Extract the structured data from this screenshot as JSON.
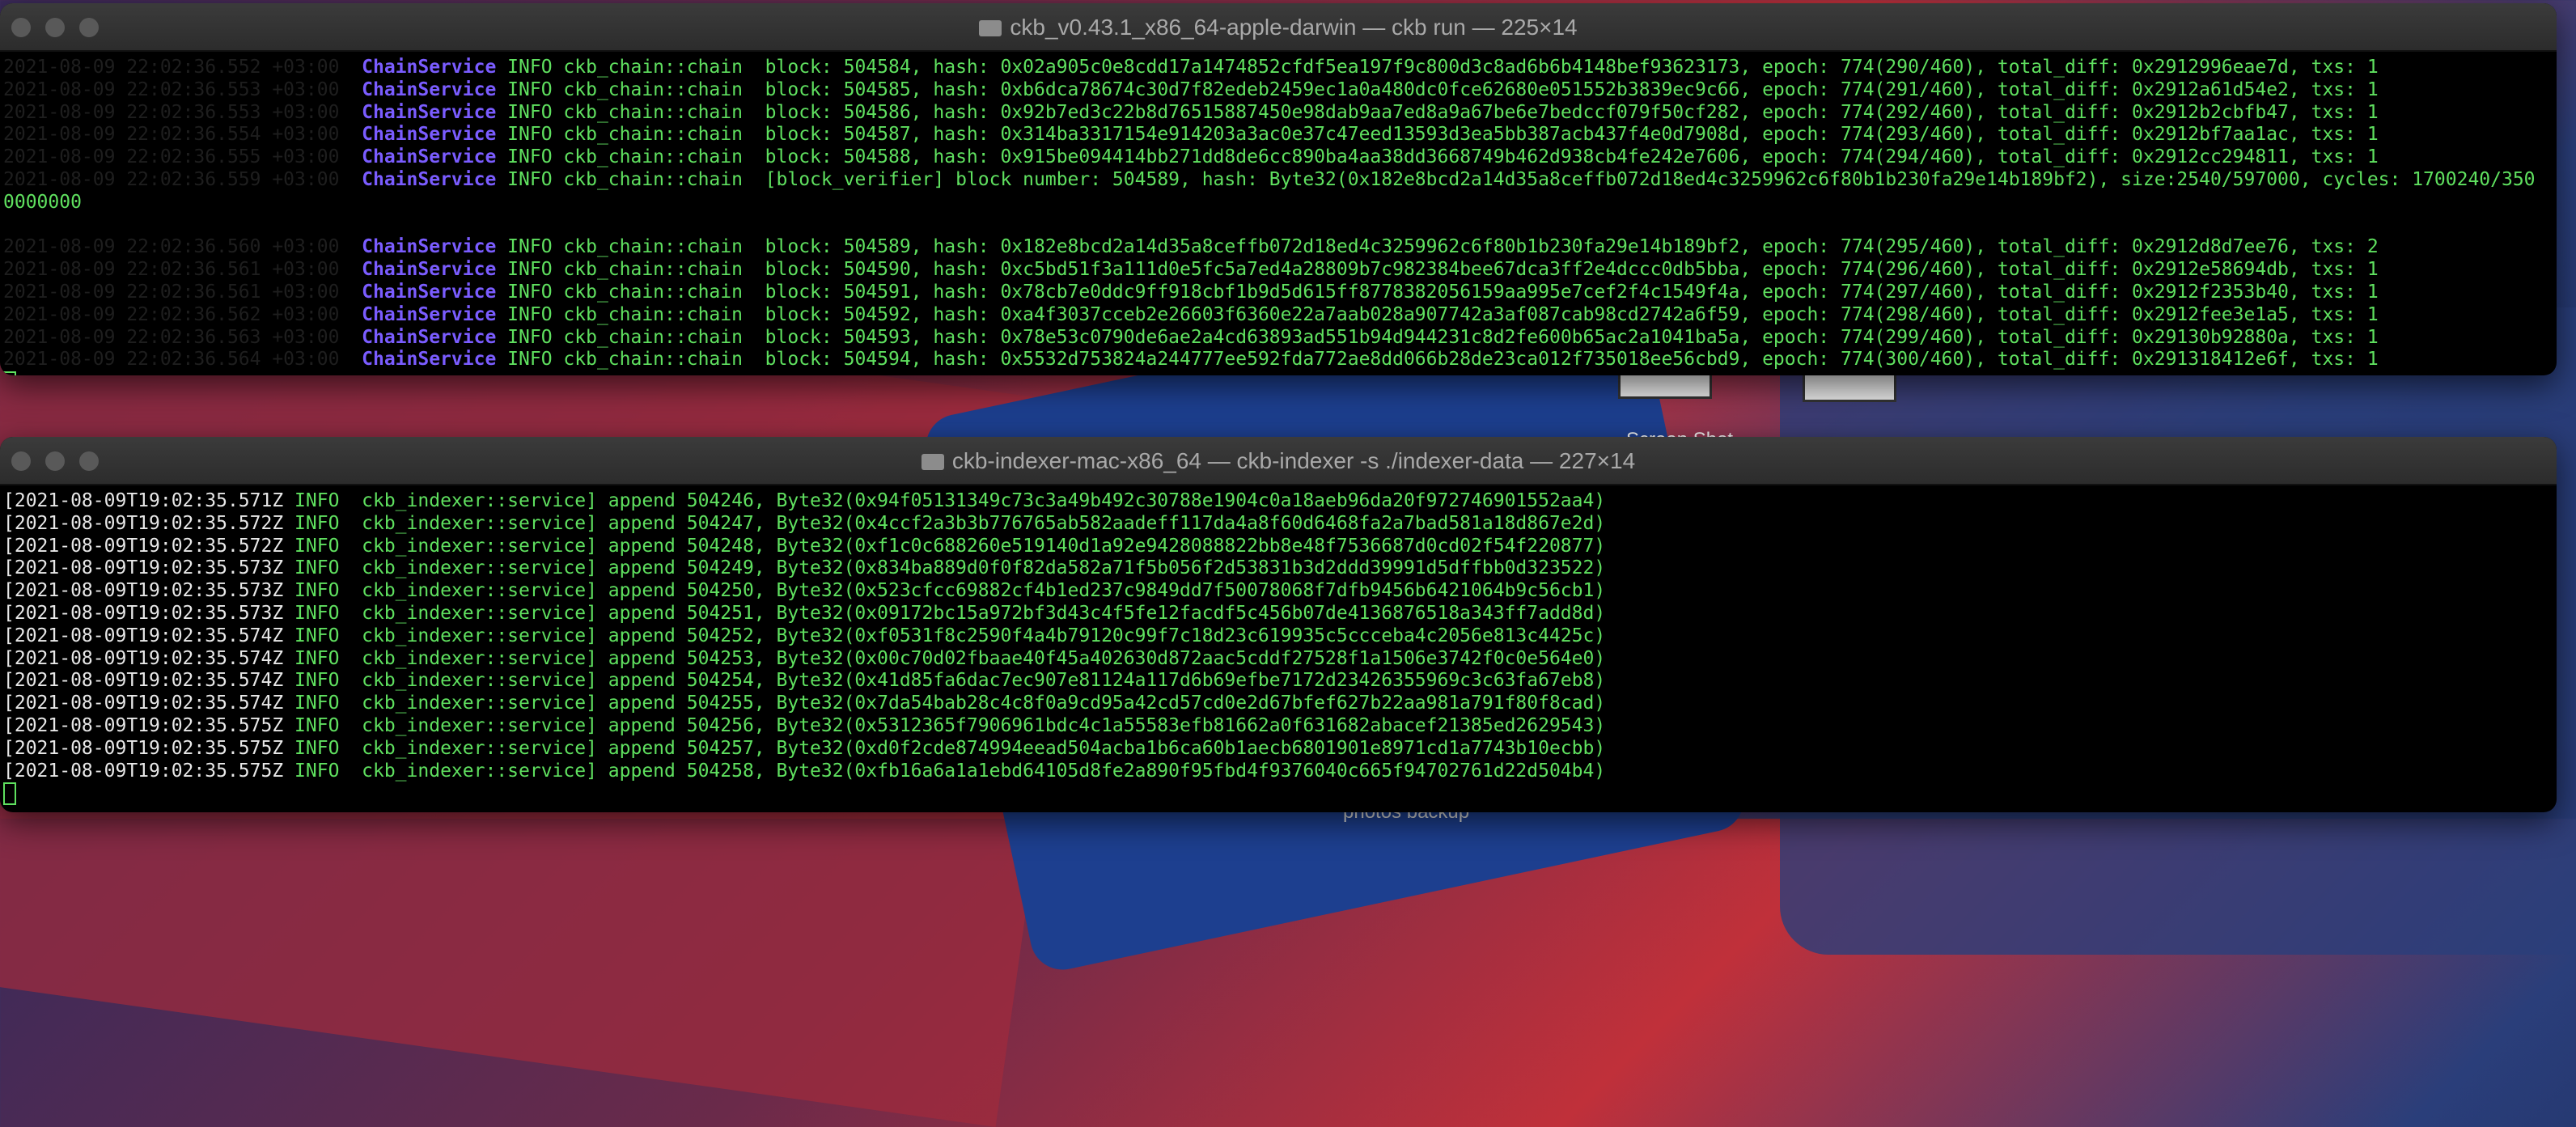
{
  "desktop": {
    "label1": "Screen Shot...",
    "label2": "photos backup"
  },
  "window1": {
    "title": "ckb_v0.43.1_x86_64-apple-darwin — ckb run — 225×14",
    "lines": [
      {
        "ts": "2021-08-09 22:02:36.552 +03:00",
        "svc": "ChainService",
        "lvl": "INFO",
        "mod": "ckb_chain::chain",
        "msg": "block: 504584, hash: 0x02a905c0e8cdd17a1474852cfdf5ea197f9c800d3c8ad6b6b4148bef93623173, epoch: 774(290/460), total_diff: 0x2912996eae7d, txs: 1"
      },
      {
        "ts": "2021-08-09 22:02:36.553 +03:00",
        "svc": "ChainService",
        "lvl": "INFO",
        "mod": "ckb_chain::chain",
        "msg": "block: 504585, hash: 0xb6dca78674c30d7f82edeb2459ec1a0a480dc0fce62680e051552b3839ec9c66, epoch: 774(291/460), total_diff: 0x2912a61d54e2, txs: 1"
      },
      {
        "ts": "2021-08-09 22:02:36.553 +03:00",
        "svc": "ChainService",
        "lvl": "INFO",
        "mod": "ckb_chain::chain",
        "msg": "block: 504586, hash: 0x92b7ed3c22b8d76515887450e98dab9aa7ed8a9a67be6e7bedccf079f50cf282, epoch: 774(292/460), total_diff: 0x2912b2cbfb47, txs: 1"
      },
      {
        "ts": "2021-08-09 22:02:36.554 +03:00",
        "svc": "ChainService",
        "lvl": "INFO",
        "mod": "ckb_chain::chain",
        "msg": "block: 504587, hash: 0x314ba3317154e914203a3ac0e37c47eed13593d3ea5bb387acb437f4e0d7908d, epoch: 774(293/460), total_diff: 0x2912bf7aa1ac, txs: 1"
      },
      {
        "ts": "2021-08-09 22:02:36.555 +03:00",
        "svc": "ChainService",
        "lvl": "INFO",
        "mod": "ckb_chain::chain",
        "msg": "block: 504588, hash: 0x915be094414bb271dd8de6cc890ba4aa38dd3668749b462d938cb4fe242e7606, epoch: 774(294/460), total_diff: 0x2912cc294811, txs: 1"
      },
      {
        "ts": "2021-08-09 22:02:36.559 +03:00",
        "svc": "ChainService",
        "lvl": "INFO",
        "mod": "ckb_chain::chain",
        "msg": "[block_verifier] block number: 504589, hash: Byte32(0x182e8bcd2a14d35a8ceffb072d18ed4c3259962c6f80b1b230fa29e14b189bf2), size:2540/597000, cycles: 1700240/350"
      },
      {
        "ts": "",
        "svc": "",
        "lvl": "",
        "mod": "",
        "msg": "",
        "cont": "0000000"
      },
      {
        "ts": "2021-08-09 22:02:36.560 +03:00",
        "svc": "ChainService",
        "lvl": "INFO",
        "mod": "ckb_chain::chain",
        "msg": "block: 504589, hash: 0x182e8bcd2a14d35a8ceffb072d18ed4c3259962c6f80b1b230fa29e14b189bf2, epoch: 774(295/460), total_diff: 0x2912d8d7ee76, txs: 2"
      },
      {
        "ts": "2021-08-09 22:02:36.561 +03:00",
        "svc": "ChainService",
        "lvl": "INFO",
        "mod": "ckb_chain::chain",
        "msg": "block: 504590, hash: 0xc5bd51f3a111d0e5fc5a7ed4a28809b7c982384bee67dca3ff2e4dccc0db5bba, epoch: 774(296/460), total_diff: 0x2912e58694db, txs: 1"
      },
      {
        "ts": "2021-08-09 22:02:36.561 +03:00",
        "svc": "ChainService",
        "lvl": "INFO",
        "mod": "ckb_chain::chain",
        "msg": "block: 504591, hash: 0x78cb7e0ddc9ff918cbf1b9d5d615ff8778382056159aa995e7cef2f4c1549f4a, epoch: 774(297/460), total_diff: 0x2912f2353b40, txs: 1"
      },
      {
        "ts": "2021-08-09 22:02:36.562 +03:00",
        "svc": "ChainService",
        "lvl": "INFO",
        "mod": "ckb_chain::chain",
        "msg": "block: 504592, hash: 0xa4f3037cceb2e26603f6360e22a7aab028a907742a3af087cab98cd2742a6f59, epoch: 774(298/460), total_diff: 0x2912fee3e1a5, txs: 1"
      },
      {
        "ts": "2021-08-09 22:02:36.563 +03:00",
        "svc": "ChainService",
        "lvl": "INFO",
        "mod": "ckb_chain::chain",
        "msg": "block: 504593, hash: 0x78e53c0790de6ae2a4cd63893ad551b94d944231c8d2fe600b65ac2a1041ba5a, epoch: 774(299/460), total_diff: 0x29130b92880a, txs: 1"
      },
      {
        "ts": "2021-08-09 22:02:36.564 +03:00",
        "svc": "ChainService",
        "lvl": "INFO",
        "mod": "ckb_chain::chain",
        "msg": "block: 504594, hash: 0x5532d753824a244777ee592fda772ae8dd066b28de23ca012f735018ee56cbd9, epoch: 774(300/460), total_diff: 0x291318412e6f, txs: 1"
      }
    ]
  },
  "window2": {
    "title": "ckb-indexer-mac-x86_64 — ckb-indexer -s ./indexer-data — 227×14",
    "lines": [
      {
        "ts": "[2021-08-09T19:02:35.571Z",
        "lvl": "INFO",
        "mod": "ckb_indexer::service]",
        "msg": "append 504246, Byte32(0x94f05131349c73c3a49b492c30788e1904c0a18aeb96da20f972746901552aa4)"
      },
      {
        "ts": "[2021-08-09T19:02:35.572Z",
        "lvl": "INFO",
        "mod": "ckb_indexer::service]",
        "msg": "append 504247, Byte32(0x4ccf2a3b3b776765ab582aadeff117da4a8f60d6468fa2a7bad581a18d867e2d)"
      },
      {
        "ts": "[2021-08-09T19:02:35.572Z",
        "lvl": "INFO",
        "mod": "ckb_indexer::service]",
        "msg": "append 504248, Byte32(0xf1c0c688260e519140d1a92e9428088822bb8e48f7536687d0cd02f54f220877)"
      },
      {
        "ts": "[2021-08-09T19:02:35.573Z",
        "lvl": "INFO",
        "mod": "ckb_indexer::service]",
        "msg": "append 504249, Byte32(0x834ba889d0f0f82da582a71f5b056f2d53831b3d2ddd39991d5dffbb0d323522)"
      },
      {
        "ts": "[2021-08-09T19:02:35.573Z",
        "lvl": "INFO",
        "mod": "ckb_indexer::service]",
        "msg": "append 504250, Byte32(0x523cfcc69882cf4b1ed237c9849dd7f50078068f7dfb9456b6421064b9c56cb1)"
      },
      {
        "ts": "[2021-08-09T19:02:35.573Z",
        "lvl": "INFO",
        "mod": "ckb_indexer::service]",
        "msg": "append 504251, Byte32(0x09172bc15a972bf3d43c4f5fe12facdf5c456b07de4136876518a343ff7add8d)"
      },
      {
        "ts": "[2021-08-09T19:02:35.574Z",
        "lvl": "INFO",
        "mod": "ckb_indexer::service]",
        "msg": "append 504252, Byte32(0xf0531f8c2590f4a4b79120c99f7c18d23c619935c5ccceba4c2056e813c4425c)"
      },
      {
        "ts": "[2021-08-09T19:02:35.574Z",
        "lvl": "INFO",
        "mod": "ckb_indexer::service]",
        "msg": "append 504253, Byte32(0x00c70d02fbaae40f45a402630d872aac5cddf27528f1a1506e3742f0c0e564e0)"
      },
      {
        "ts": "[2021-08-09T19:02:35.574Z",
        "lvl": "INFO",
        "mod": "ckb_indexer::service]",
        "msg": "append 504254, Byte32(0x41d85fa6dac7ec907e81124a117d6b69efbe7172d23426355969c3c63fa67eb8)"
      },
      {
        "ts": "[2021-08-09T19:02:35.574Z",
        "lvl": "INFO",
        "mod": "ckb_indexer::service]",
        "msg": "append 504255, Byte32(0x7da54bab28c4c8f0a9cd95a42cd57cd0e2d67bfef627b22aa981a791f80f8cad)"
      },
      {
        "ts": "[2021-08-09T19:02:35.575Z",
        "lvl": "INFO",
        "mod": "ckb_indexer::service]",
        "msg": "append 504256, Byte32(0x5312365f7906961bdc4c1a55583efb81662a0f631682abacef21385ed2629543)"
      },
      {
        "ts": "[2021-08-09T19:02:35.575Z",
        "lvl": "INFO",
        "mod": "ckb_indexer::service]",
        "msg": "append 504257, Byte32(0xd0f2cde874994eead504acba1b6ca60b1aecb6801901e8971cd1a7743b10ecbb)"
      },
      {
        "ts": "[2021-08-09T19:02:35.575Z",
        "lvl": "INFO",
        "mod": "ckb_indexer::service]",
        "msg": "append 504258, Byte32(0xfb16a6a1a1ebd64105d8fe2a890f95fbd4f9376040c665f94702761d22d504b4)"
      }
    ]
  }
}
